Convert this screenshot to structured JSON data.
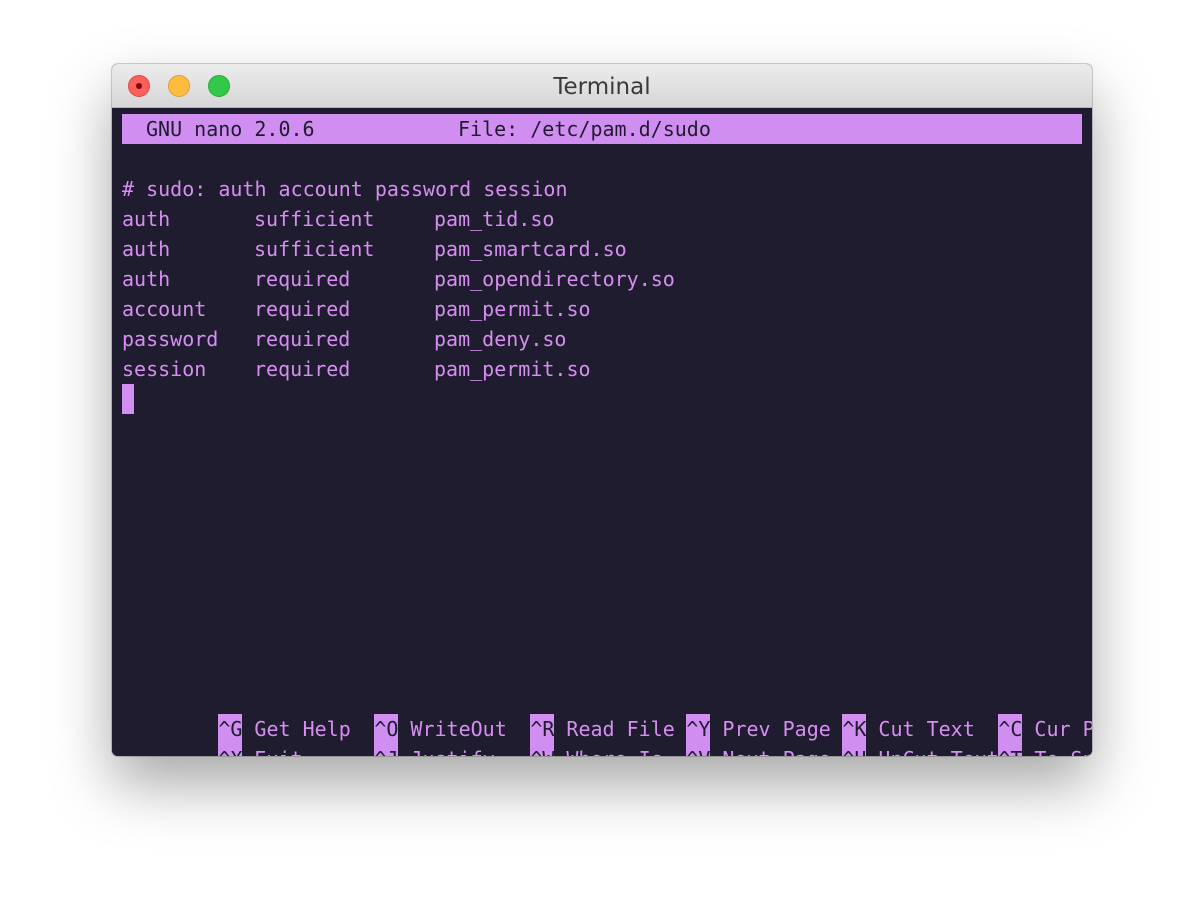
{
  "window": {
    "title": "Terminal"
  },
  "nano": {
    "version": "GNU nano 2.0.6",
    "file_label": "File: /etc/pam.d/sudo"
  },
  "editor": {
    "lines": [
      {
        "text": "# sudo: auth account password session"
      },
      {
        "type": "auth",
        "control": "sufficient",
        "module": "pam_tid.so"
      },
      {
        "type": "auth",
        "control": "sufficient",
        "module": "pam_smartcard.so"
      },
      {
        "type": "auth",
        "control": "required",
        "module": "pam_opendirectory.so"
      },
      {
        "type": "account",
        "control": "required",
        "module": "pam_permit.so"
      },
      {
        "type": "password",
        "control": "required",
        "module": "pam_deny.so"
      },
      {
        "type": "session",
        "control": "required",
        "module": "pam_permit.so"
      }
    ]
  },
  "shortcuts": [
    [
      {
        "key": "^G",
        "label": "Get Help"
      },
      {
        "key": "^O",
        "label": "WriteOut"
      },
      {
        "key": "^R",
        "label": "Read File"
      },
      {
        "key": "^Y",
        "label": "Prev Page"
      },
      {
        "key": "^K",
        "label": "Cut Text"
      },
      {
        "key": "^C",
        "label": "Cur Pos"
      }
    ],
    [
      {
        "key": "^X",
        "label": "Exit"
      },
      {
        "key": "^J",
        "label": "Justify"
      },
      {
        "key": "^W",
        "label": "Where Is"
      },
      {
        "key": "^V",
        "label": "Next Page"
      },
      {
        "key": "^U",
        "label": "UnCut Text"
      },
      {
        "key": "^T",
        "label": "To Spell"
      }
    ]
  ],
  "colors": {
    "terminal_bg": "#1f1c2f",
    "accent": "#d08ef0"
  }
}
